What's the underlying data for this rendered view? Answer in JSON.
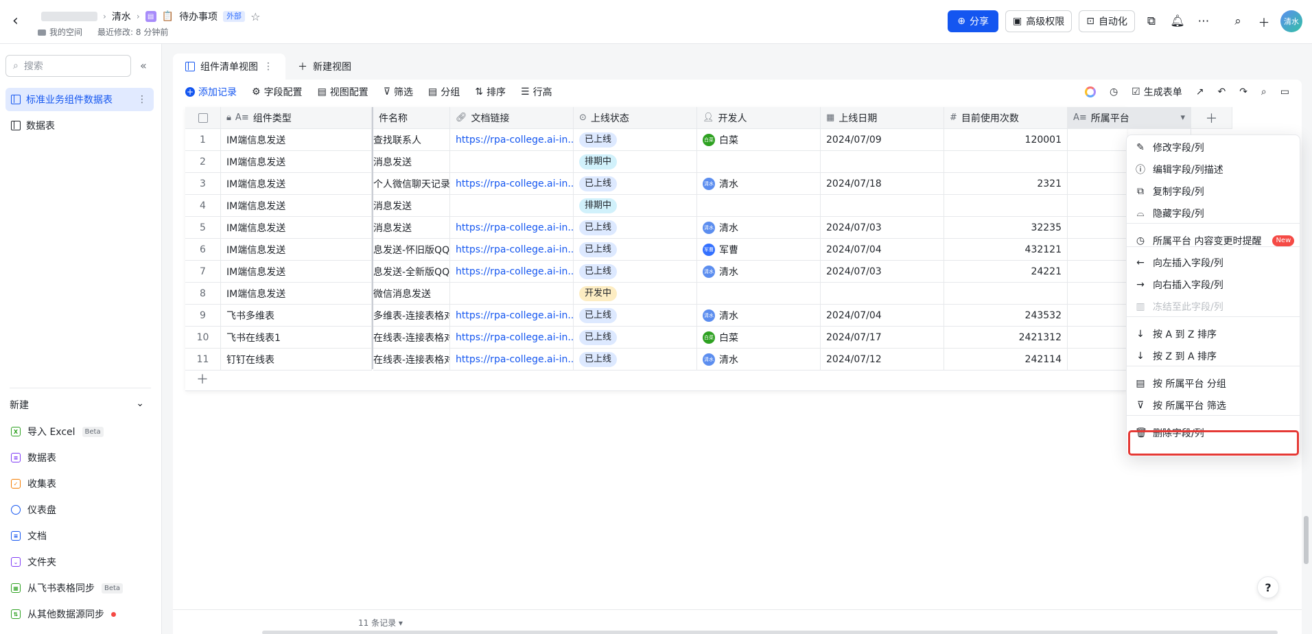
{
  "header": {
    "breadcrumb_user": "清水",
    "doc_title": "待办事项",
    "external_badge": "外部",
    "space_label": "我的空间",
    "last_modified": "最近修改: 8 分钟前",
    "share_label": "分享",
    "advanced_perm_label": "高级权限",
    "automation_label": "自动化",
    "avatar_text": "清水"
  },
  "sidebar": {
    "search_placeholder": "搜索",
    "items": [
      {
        "label": "标准业务组件数据表"
      },
      {
        "label": "数据表"
      }
    ],
    "new_heading": "新建",
    "new_items": [
      {
        "label": "导入 Excel",
        "badge": "Beta",
        "color": "#2ea121",
        "glyph": "X"
      },
      {
        "label": "数据表",
        "color": "#7f3bf5",
        "glyph": ""
      },
      {
        "label": "收集表",
        "color": "#f57c00",
        "glyph": ""
      },
      {
        "label": "仪表盘",
        "color": "#1456f0",
        "glyph": ""
      },
      {
        "label": "文档",
        "color": "#1456f0",
        "glyph": ""
      },
      {
        "label": "文件夹",
        "color": "#7f3bf5",
        "glyph": ""
      },
      {
        "label": "从飞书表格同步",
        "badge": "Beta",
        "color": "#2ea121",
        "glyph": ""
      },
      {
        "label": "从其他数据源同步",
        "color": "#2ea121",
        "glyph": ""
      }
    ]
  },
  "views": {
    "active_view": "组件清单视图",
    "new_view": "新建视图"
  },
  "toolbar": {
    "add_record": "添加记录",
    "field_config": "字段配置",
    "view_config": "视图配置",
    "filter": "筛选",
    "group": "分组",
    "sort": "排序",
    "row_height": "行高",
    "generate_form": "生成表单"
  },
  "table": {
    "columns": [
      "组件类型",
      "件名称",
      "文档链接",
      "上线状态",
      "开发人",
      "上线日期",
      "目前使用次数",
      "所属平台"
    ],
    "rows": [
      {
        "n": "1",
        "type": "IM端信息发送",
        "name": "查找联系人",
        "link": "https://rpa-college.ai-in...",
        "status": "已上线",
        "status_kind": "on",
        "dev": "白菜",
        "dev_av": "白菜",
        "dev_color": "#2ea121",
        "date": "2024/07/09",
        "count": "120001"
      },
      {
        "n": "2",
        "type": "IM端信息发送",
        "name": "消息发送",
        "link": "",
        "status": "排期中",
        "status_kind": "q",
        "dev": "",
        "dev_av": "",
        "dev_color": "",
        "date": "",
        "count": ""
      },
      {
        "n": "3",
        "type": "IM端信息发送",
        "name": "个人微信聊天记录",
        "link": "https://rpa-college.ai-in...",
        "status": "已上线",
        "status_kind": "on",
        "dev": "清水",
        "dev_av": "清水",
        "dev_color": "#5b8def",
        "date": "2024/07/18",
        "count": "2321"
      },
      {
        "n": "4",
        "type": "IM端信息发送",
        "name": "消息发送",
        "link": "",
        "status": "排期中",
        "status_kind": "q",
        "dev": "",
        "dev_av": "",
        "dev_color": "",
        "date": "",
        "count": ""
      },
      {
        "n": "5",
        "type": "IM端信息发送",
        "name": "消息发送",
        "link": "https://rpa-college.ai-in...",
        "status": "已上线",
        "status_kind": "on",
        "dev": "清水",
        "dev_av": "清水",
        "dev_color": "#5b8def",
        "date": "2024/07/03",
        "count": "32235"
      },
      {
        "n": "6",
        "type": "IM端信息发送",
        "name": "息发送-怀旧版QQ",
        "link": "https://rpa-college.ai-in...",
        "status": "已上线",
        "status_kind": "on",
        "dev": "军曹",
        "dev_av": "军曹",
        "dev_color": "#3370ff",
        "date": "2024/07/04",
        "count": "432121"
      },
      {
        "n": "7",
        "type": "IM端信息发送",
        "name": "息发送-全新版QQ",
        "link": "https://rpa-college.ai-in...",
        "status": "已上线",
        "status_kind": "on",
        "dev": "清水",
        "dev_av": "清水",
        "dev_color": "#5b8def",
        "date": "2024/07/03",
        "count": "24221"
      },
      {
        "n": "8",
        "type": "IM端信息发送",
        "name": "微信消息发送",
        "link": "",
        "status": "开发中",
        "status_kind": "dev",
        "dev": "",
        "dev_av": "",
        "dev_color": "",
        "date": "",
        "count": ""
      },
      {
        "n": "9",
        "type": "飞书多维表",
        "name": "多维表-连接表格对象",
        "link": "https://rpa-college.ai-in...",
        "status": "已上线",
        "status_kind": "on",
        "dev": "清水",
        "dev_av": "清水",
        "dev_color": "#5b8def",
        "date": "2024/07/04",
        "count": "243532"
      },
      {
        "n": "10",
        "type": "飞书在线表1",
        "name": "在线表-连接表格对象",
        "link": "https://rpa-college.ai-in...",
        "status": "已上线",
        "status_kind": "on",
        "dev": "白菜",
        "dev_av": "白菜",
        "dev_color": "#2ea121",
        "date": "2024/07/17",
        "count": "2421312"
      },
      {
        "n": "11",
        "type": "钉钉在线表",
        "name": "在线表-连接表格对象",
        "link": "https://rpa-college.ai-in...",
        "status": "已上线",
        "status_kind": "on",
        "dev": "清水",
        "dev_av": "清水",
        "dev_color": "#5b8def",
        "date": "2024/07/12",
        "count": "242114"
      }
    ]
  },
  "context_menu": {
    "items": [
      {
        "label": "修改字段/列",
        "icon": "edit-icon",
        "glyph": "✎"
      },
      {
        "label": "编辑字段/列描述",
        "icon": "info-icon",
        "glyph": "ⓘ"
      },
      {
        "label": "复制字段/列",
        "icon": "copy-icon",
        "glyph": "⧉"
      },
      {
        "label": "隐藏字段/列",
        "icon": "eye-off-icon",
        "glyph": "⌓"
      },
      {
        "label": "所属平台 内容变更时提醒",
        "icon": "clock-icon",
        "glyph": "◷",
        "tag": "New"
      },
      {
        "label": "向左插入字段/列",
        "icon": "arrow-left-icon",
        "glyph": "←"
      },
      {
        "label": "向右插入字段/列",
        "icon": "arrow-right-icon",
        "glyph": "→"
      },
      {
        "label": "冻结至此字段/列",
        "icon": "freeze-icon",
        "glyph": "▥",
        "disabled": true
      },
      {
        "label": "按 A 到 Z 排序",
        "icon": "sort-asc-icon",
        "glyph": "↓"
      },
      {
        "label": "按 Z 到 A 排序",
        "icon": "sort-desc-icon",
        "glyph": "↓"
      },
      {
        "label": "按 所属平台 分组",
        "icon": "group-icon",
        "glyph": "▤"
      },
      {
        "label": "按 所属平台 筛选",
        "icon": "filter-icon",
        "glyph": "⊽"
      },
      {
        "label": "删除字段/列",
        "icon": "trash-icon",
        "glyph": "🗑"
      }
    ]
  },
  "footer": {
    "record_count": "11 条记录"
  }
}
